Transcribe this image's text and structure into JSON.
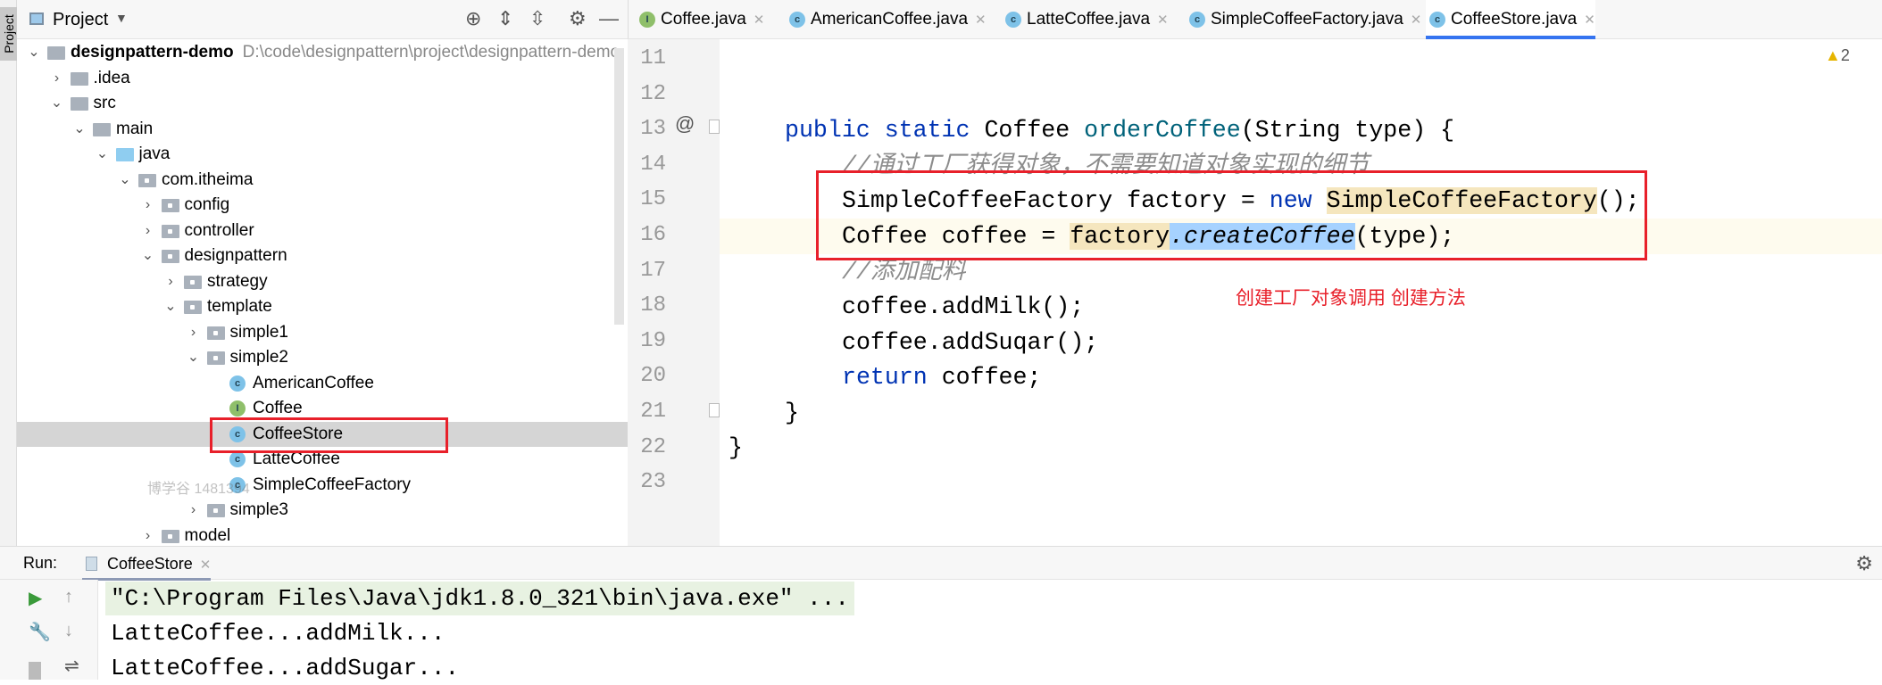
{
  "sidebar_stripe": {
    "label": "Project"
  },
  "project_panel": {
    "title": "Project",
    "root": {
      "name": "designpattern-demo",
      "path": "D:\\code\\designpattern\\project\\designpattern-demo"
    },
    "items": [
      {
        "label": ".idea"
      },
      {
        "label": "src"
      },
      {
        "label": "main"
      },
      {
        "label": "java"
      },
      {
        "label": "com.itheima"
      },
      {
        "label": "config"
      },
      {
        "label": "controller"
      },
      {
        "label": "designpattern"
      },
      {
        "label": "strategy"
      },
      {
        "label": "template"
      },
      {
        "label": "simple1"
      },
      {
        "label": "simple2"
      },
      {
        "label": "AmericanCoffee"
      },
      {
        "label": "Coffee"
      },
      {
        "label": "CoffeeStore"
      },
      {
        "label": "LatteCoffee"
      },
      {
        "label": "SimpleCoffeeFactory"
      },
      {
        "label": "simple3"
      },
      {
        "label": "model"
      }
    ],
    "selected": "CoffeeStore",
    "watermark": "博学谷 1481394"
  },
  "tabs": [
    {
      "label": "Coffee.java",
      "type": "I"
    },
    {
      "label": "AmericanCoffee.java",
      "type": "C"
    },
    {
      "label": "LatteCoffee.java",
      "type": "C"
    },
    {
      "label": "SimpleCoffeeFactory.java",
      "type": "C"
    },
    {
      "label": "CoffeeStore.java",
      "type": "C",
      "active": true
    }
  ],
  "editor": {
    "warnings": "2",
    "line_numbers": [
      "11",
      "12",
      "13",
      "14",
      "15",
      "16",
      "17",
      "18",
      "19",
      "20",
      "21",
      "22",
      "23"
    ],
    "code": {
      "l13_kw": "public static ",
      "l13_type": "Coffee ",
      "l13_fn": "orderCoffee",
      "l13_rest": "(String type) {",
      "l14": "//通过工厂获得对象，不需要知道对象实现的细节",
      "l15_a": "SimpleCoffeeFactory factory = ",
      "l15_kw": "new ",
      "l15_b": "SimpleCoffeeFactory",
      "l15_c": "();",
      "l16_a": "Coffee coffee = ",
      "l16_b": "factory",
      "l16_c": ".createCoffee",
      "l16_d": "(type);",
      "l17": "//添加配料",
      "l18": "coffee.addMilk();",
      "l19": "coffee.addSuqar();",
      "l20_kw": "return ",
      "l20_rest": "coffee;",
      "l21": "}",
      "l22": "}"
    },
    "annotation": "创建工厂对象调用 创建方法",
    "highlight_color": "#e8202a"
  },
  "run": {
    "label": "Run:",
    "tab": "CoffeeStore",
    "output": [
      "\"C:\\Program Files\\Java\\jdk1.8.0_321\\bin\\java.exe\" ...",
      "LatteCoffee...addMilk...",
      "LatteCoffee...addSugar..."
    ]
  }
}
